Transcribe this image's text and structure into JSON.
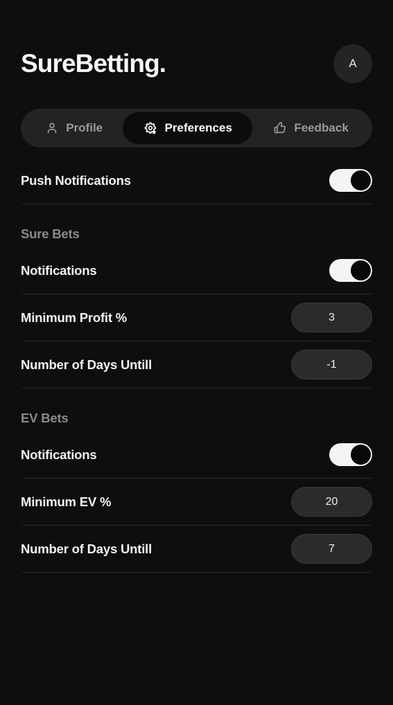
{
  "header": {
    "brand": "SureBetting.",
    "avatar_initial": "A"
  },
  "tabs": [
    {
      "label": "Profile",
      "icon": "person-icon",
      "active": false
    },
    {
      "label": "Preferences",
      "icon": "settings-gear-star-icon",
      "active": true
    },
    {
      "label": "Feedback",
      "icon": "thumbs-up-icon",
      "active": false
    }
  ],
  "settings": {
    "push_notifications": {
      "label": "Push Notifications",
      "value": "on"
    },
    "sure_bets": {
      "section_title": "Sure Bets",
      "notifications_label": "Notifications",
      "notifications_value": "on",
      "minimum_profit_label": "Minimum Profit %",
      "minimum_profit_value": "3",
      "days_until_label": "Number of Days Untill",
      "days_until_value": "-1"
    },
    "ev_bets": {
      "section_title": "EV Bets",
      "notifications_label": "Notifications",
      "notifications_value": "on",
      "minimum_ev_label": "Minimum EV %",
      "minimum_ev_value": "20",
      "days_until_label": "Number of Days Untill",
      "days_until_value": "7"
    }
  },
  "colors": {
    "background": "#0e0e0e",
    "tabbar": "#232323",
    "active_tab": "#0c0c0c",
    "divider": "#262d3c",
    "muted_text": "#8b8b8b",
    "pill": "#2b2b2b",
    "toggle_on": "#f4f4f4"
  }
}
